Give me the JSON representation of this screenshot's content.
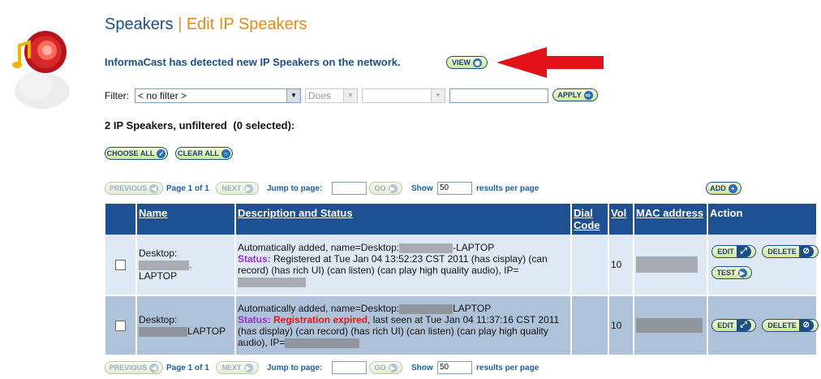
{
  "page": {
    "title_part1": "Speakers",
    "title_separator": "|",
    "title_part2": "Edit IP Speakers",
    "notice": "InformaCast has detected new IP Speakers on the network.",
    "view_button": "VIEW"
  },
  "filter": {
    "label": "Filter:",
    "field_value": "< no filter >",
    "operator_value": "Does",
    "condition_value": "",
    "text_value": "",
    "apply_button": "APPLY"
  },
  "summary": {
    "count": "2",
    "text": "IP Speakers, unfiltered",
    "selected": "(0 selected):"
  },
  "selection": {
    "choose_all": "CHOOSE ALL",
    "clear_all": "CLEAR ALL"
  },
  "pager": {
    "previous": "PREVIOUS",
    "page_info": "Page 1 of 1",
    "next": "NEXT",
    "jump_label": "Jump to page:",
    "jump_value": "",
    "go": "GO",
    "show_label": "Show",
    "show_value": "50",
    "results_label": "results per page",
    "add_button": "ADD"
  },
  "table": {
    "headers": {
      "name": "Name",
      "description": "Description and Status",
      "dial_code": "Dial Code",
      "vol": "Vol",
      "mac": "MAC address",
      "action": "Action"
    },
    "rows": [
      {
        "name_prefix": "Desktop:",
        "name_suffix": "LAPTOP",
        "desc_prefix": "Automatically added, name=Desktop:",
        "desc_suffix": "-LAPTOP",
        "status_label": "Status:",
        "status_text": "Registered at Tue Jan 04 13:52:23 CST 2011 (has cisplay) (can record) (has rich UI) (can listen) (can play high quality audio),",
        "ip_label": "IP=",
        "dial_code": "",
        "vol": "10",
        "edit": "EDIT",
        "delete": "DELETE",
        "test": "TEST"
      },
      {
        "name_prefix": "Desktop:",
        "name_suffix": "LAPTOP",
        "desc_prefix": "Automatically added, name=Desktop:",
        "desc_suffix": "LAPTOP",
        "status_label": "Status:",
        "status_expired": "Registration expired",
        "status_text": ", last seen at Tue Jan 04 11:37:16 CST 2011 (has display) (can record) (has rich UI) (can listen) (can play high quality audio),",
        "ip_label": "IP=",
        "dial_code": "",
        "vol": "10",
        "edit": "EDIT",
        "delete": "DELETE"
      }
    ]
  },
  "colors": {
    "header_blue": "#1d5193",
    "title_blue": "#1c4f88",
    "title_orange": "#e08a1a",
    "status_purple": "#9c2fd0",
    "status_red": "#e01818",
    "arrow_red": "#e3121a"
  },
  "icons": [
    "informacast-logo-icon",
    "eye-icon",
    "check-icon",
    "circle-icon",
    "arrow-left-icon",
    "arrow-right-icon",
    "plus-icon",
    "resize-icon",
    "no-entry-icon",
    "dropdown-arrow-icon",
    "red-arrow-icon"
  ]
}
